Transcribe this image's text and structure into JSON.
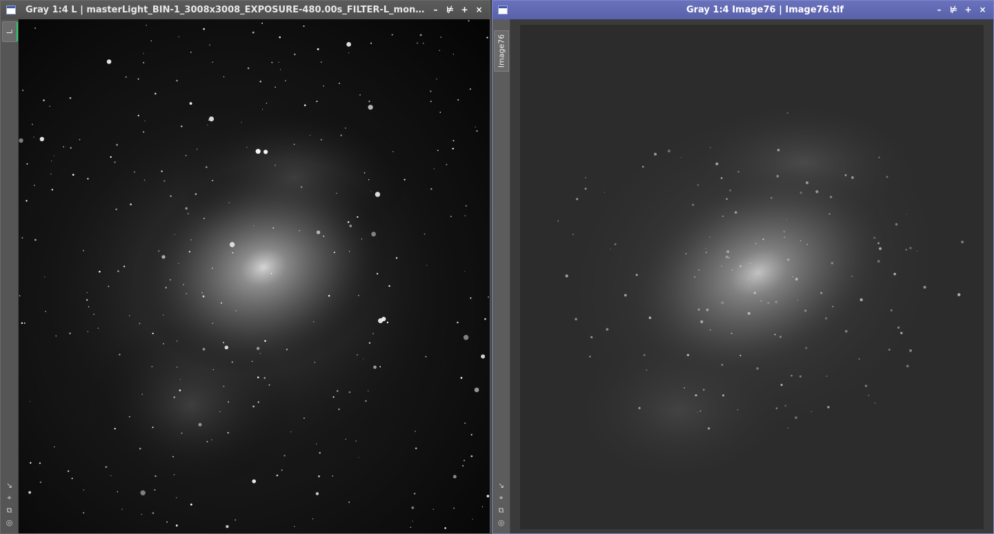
{
  "windows": {
    "left": {
      "title": "Gray 1:4 L | masterLight_BIN-1_3008x3008_EXPOSURE-480.00s_FILTER-L_mono…",
      "tab_label": "L",
      "image_name": "galaxy-image-left"
    },
    "right": {
      "title": "Gray 1:4 Image76 | Image76.tif",
      "tab_label": "Image76",
      "image_name": "galaxy-image-right"
    }
  },
  "window_buttons": {
    "minimize": "minimize-icon",
    "shade": "shade-icon",
    "maximize": "maximize-icon",
    "close": "close-icon"
  },
  "sidebar_tools": [
    "fit-view-icon",
    "zoom-fit-icon",
    "clone-icon",
    "target-icon"
  ],
  "colors": {
    "active_title_bar": "#5d64ad",
    "inactive_title_bar": "#555555",
    "tab_marker": "#2bd26b",
    "background": "#3a3a3a"
  }
}
